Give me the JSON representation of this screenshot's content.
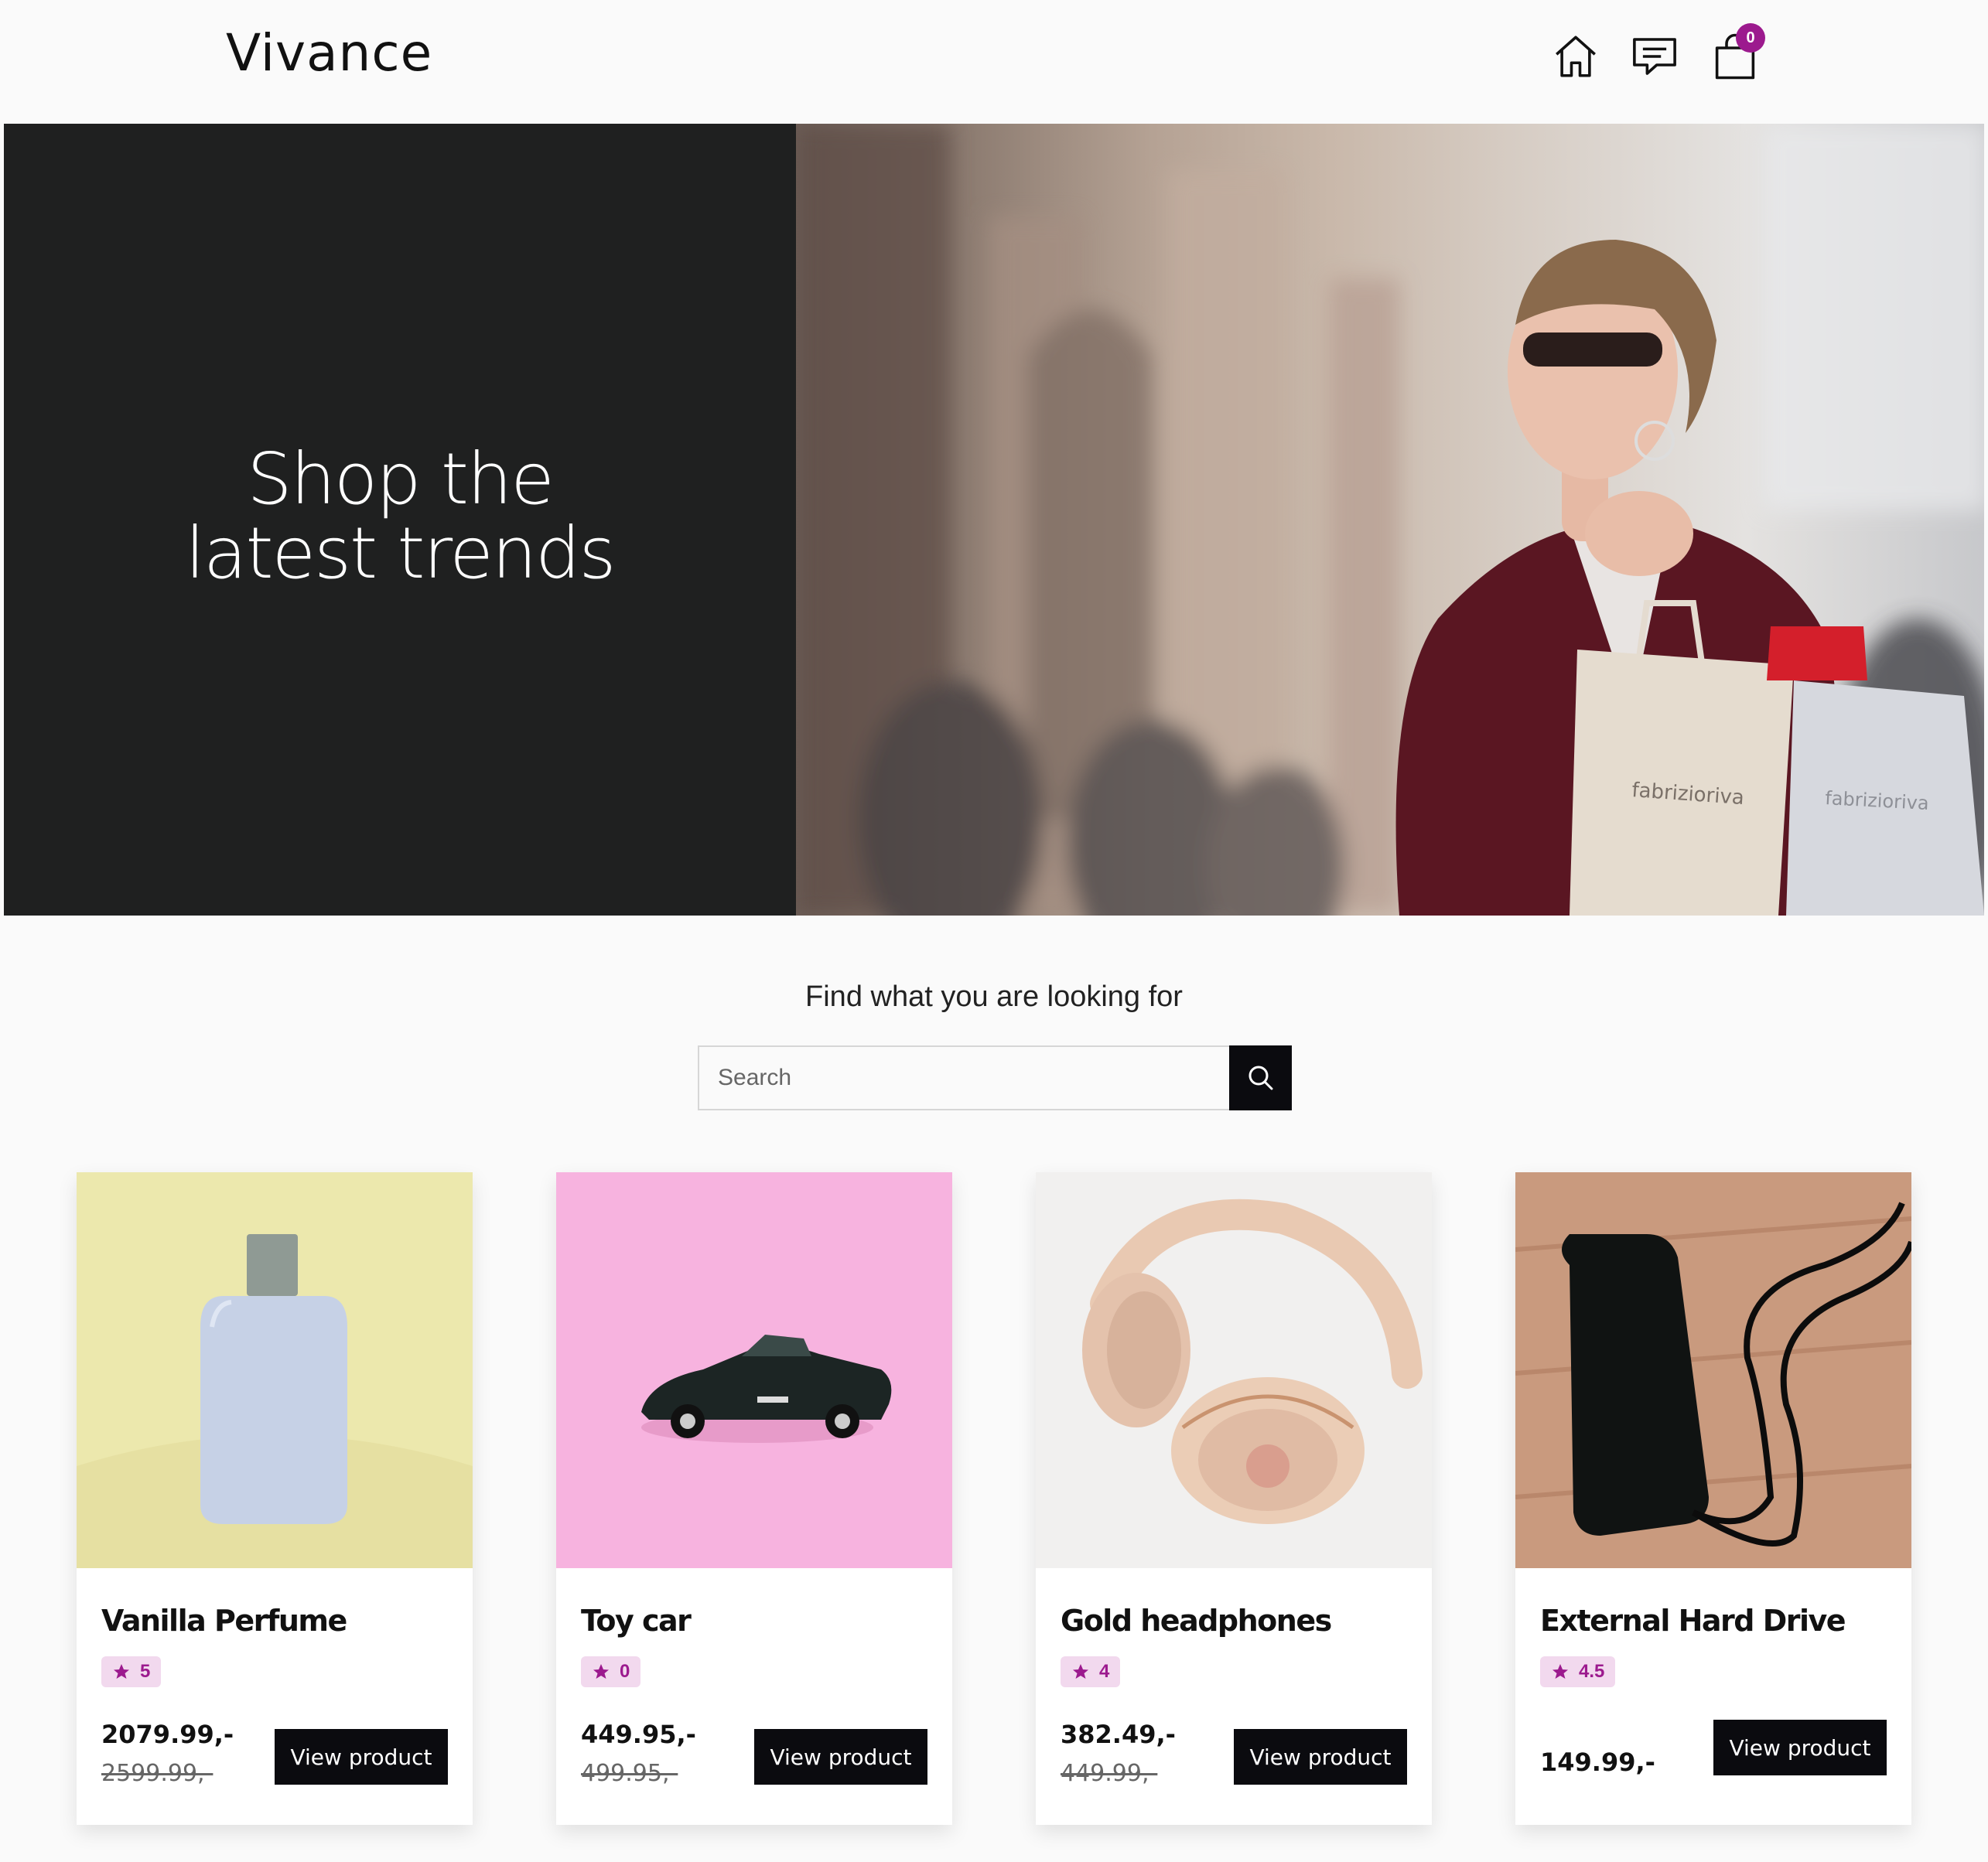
{
  "header": {
    "logo": "Vivance",
    "cart_count": "0",
    "icons": [
      "home-icon",
      "chat-icon",
      "shopping-bag-icon"
    ]
  },
  "hero": {
    "line1": "Shop the",
    "line2": "latest trends"
  },
  "search": {
    "title": "Find what you are looking for",
    "placeholder": "Search"
  },
  "colors": {
    "accent": "#9c1a8e",
    "dark": "#0b0b0f",
    "hero_bg": "#1f2020"
  },
  "products": [
    {
      "name": "Vanilla Perfume",
      "rating": "5",
      "price": "2079.99,-",
      "old_price": "2599.99,-",
      "button": "View product"
    },
    {
      "name": "Toy car",
      "rating": "0",
      "price": "449.95,-",
      "old_price": "499.95,-",
      "button": "View product"
    },
    {
      "name": "Gold headphones",
      "rating": "4",
      "price": "382.49,-",
      "old_price": "449.99,-",
      "button": "View product"
    },
    {
      "name": "External Hard Drive",
      "rating": "4.5",
      "price": "149.99,-",
      "button": "View product"
    }
  ]
}
